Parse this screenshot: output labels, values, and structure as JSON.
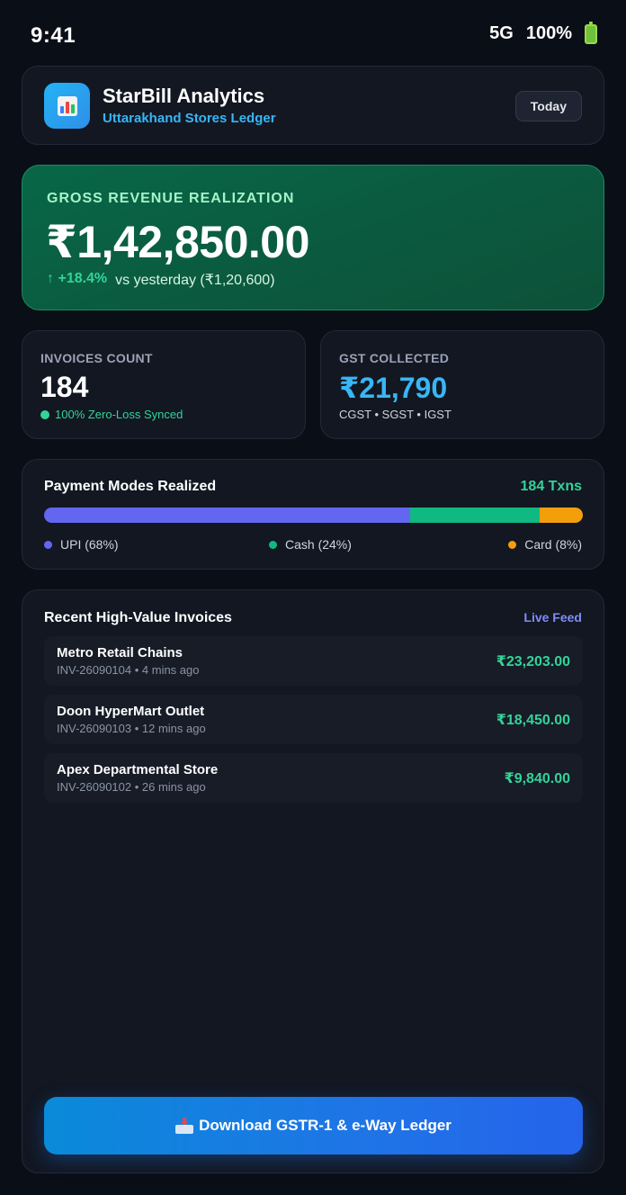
{
  "status_bar": {
    "time": "9:41",
    "network": "5G",
    "battery": "100%",
    "battery_icon": "battery-full-icon"
  },
  "header": {
    "logo_icon": "bar-chart-icon",
    "title": "StarBill Analytics",
    "subtitle": "Uttarakhand Stores Ledger",
    "period_button": "Today"
  },
  "revenue": {
    "label": "GROSS REVENUE REALIZATION",
    "value": "₹1,42,850.00",
    "delta": "↑ +18.4%",
    "comparison": "vs yesterday (₹1,20,600)"
  },
  "stats": {
    "invoices": {
      "label": "INVOICES COUNT",
      "value": "184",
      "sub": "100% Zero-Loss Synced"
    },
    "gst": {
      "label": "GST COLLECTED",
      "value": "₹21,790",
      "sub": "CGST • SGST • IGST"
    }
  },
  "payments": {
    "title": "Payment Modes Realized",
    "count": "184 Txns",
    "modes": [
      {
        "label": "UPI (68%)",
        "share": 68,
        "color": "#6366f1"
      },
      {
        "label": "Cash (24%)",
        "share": 24,
        "color": "#10b981"
      },
      {
        "label": "Card (8%)",
        "share": 8,
        "color": "#f59e0b"
      }
    ]
  },
  "invoices": {
    "title": "Recent High-Value Invoices",
    "feed_label": "Live Feed",
    "items": [
      {
        "name": "Metro Retail Chains",
        "meta": "INV-26090104 • 4 mins ago",
        "amount": "₹23,203.00"
      },
      {
        "name": "Doon HyperMart Outlet",
        "meta": "INV-26090103 • 12 mins ago",
        "amount": "₹18,450.00"
      },
      {
        "name": "Apex Departmental Store",
        "meta": "INV-26090102 • 26 mins ago",
        "amount": "₹9,840.00"
      }
    ],
    "download_icon": "inbox-tray-icon",
    "download_label": "Download GSTR-1 & e-Way Ledger"
  },
  "colors": {
    "accent_blue": "#38b6f5",
    "success_green": "#34d399",
    "indigo": "#818cf8"
  }
}
